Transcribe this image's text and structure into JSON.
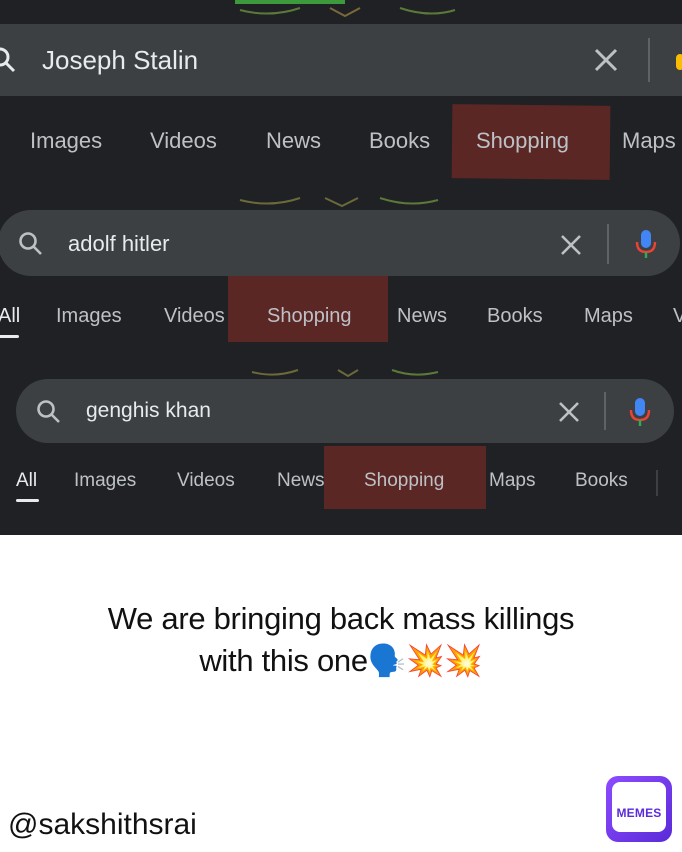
{
  "panels": [
    {
      "query": "Joseph Stalin",
      "tabs": [
        "Images",
        "Videos",
        "News",
        "Books",
        "Shopping",
        "Maps"
      ],
      "highlighted_tab": "Shopping"
    },
    {
      "query": "adolf hitler",
      "tabs": [
        "All",
        "Images",
        "Videos",
        "Shopping",
        "News",
        "Books",
        "Maps",
        "V"
      ],
      "highlighted_tab": "Shopping"
    },
    {
      "query": "genghis khan",
      "tabs": [
        "All",
        "Images",
        "Videos",
        "News",
        "Shopping",
        "Maps",
        "Books"
      ],
      "highlighted_tab": "Shopping"
    }
  ],
  "caption": {
    "line1": "We are bringing back mass killings",
    "line2": "with this one🗣️💥💥"
  },
  "watermark_handle": "@sakshithsrai",
  "logo_text": "MEMES",
  "colors": {
    "background": "#202124",
    "searchbar": "#3c4043",
    "highlight": "#5b2725",
    "text": "#bdc1c6"
  },
  "icons": [
    "search-icon",
    "close-icon",
    "mic-icon",
    "memes-logo"
  ]
}
